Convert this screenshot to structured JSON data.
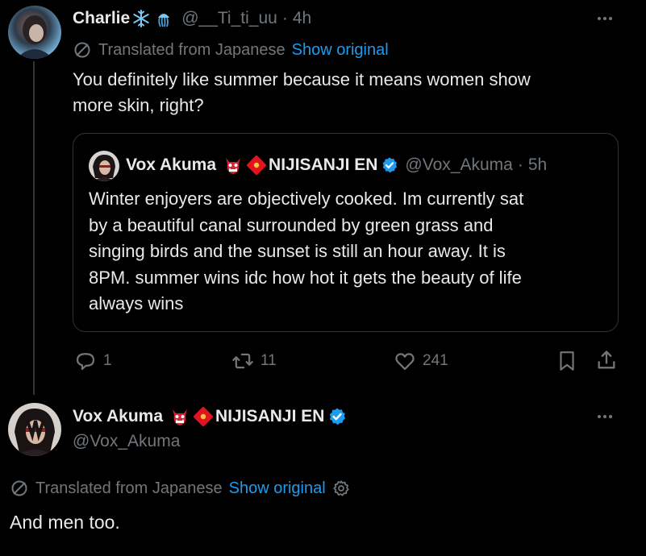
{
  "reply": {
    "author_name": "Charlie",
    "author_handle": "@__Ti_ti_uu",
    "separator": "·",
    "time": "4h",
    "translated_label": "Translated from Japanese",
    "show_original": "Show original",
    "text_line1": "You definitely like summer because it means women show",
    "text_line2": "more skin, right?",
    "quote": {
      "author_name": "Vox Akuma",
      "author_suffix": "NIJISANJI EN",
      "author_handle": "@Vox_Akuma",
      "separator": "·",
      "time": "5h",
      "lines": [
        "Winter enjoyers are objectively cooked. Im currently sat",
        "by a beautiful canal surrounded by green grass and",
        "singing birds and the sunset is still an hour away. It is",
        "8PM. summer wins idc how hot it gets the beauty of life",
        "always wins"
      ]
    },
    "actions": {
      "replies": "1",
      "reposts": "11",
      "likes": "241"
    }
  },
  "main": {
    "author_name": "Vox Akuma",
    "author_suffix": "NIJISANJI EN",
    "author_handle": "@Vox_Akuma",
    "translated_label": "Translated from Japanese",
    "show_original": "Show original",
    "text": "And men too."
  },
  "colors": {
    "background": "#000000",
    "text": "#e7e9ea",
    "muted": "#71767b",
    "accent": "#1d9bf0"
  },
  "icons": [
    "snowflake-icon",
    "jellyfish-icon",
    "translate-icon",
    "more-icon",
    "verified-icon",
    "oni-mask-icon",
    "red-envelope-icon",
    "reply-icon",
    "repost-icon",
    "like-icon",
    "bookmark-icon",
    "share-icon",
    "settings-icon"
  ]
}
